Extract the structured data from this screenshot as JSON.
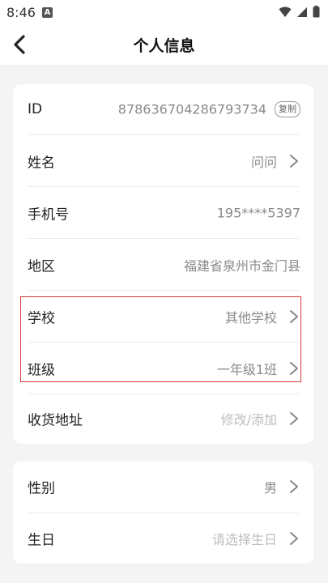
{
  "status_bar": {
    "time": "8:46",
    "notification_letter": "A"
  },
  "nav": {
    "title": "个人信息"
  },
  "profile": {
    "id": {
      "label": "ID",
      "value": "878636704286793734",
      "copy_label": "复制"
    },
    "name": {
      "label": "姓名",
      "value": "问问"
    },
    "phone": {
      "label": "手机号",
      "value": "195****5397"
    },
    "region": {
      "label": "地区",
      "value": "福建省泉州市金门县"
    },
    "school": {
      "label": "学校",
      "value": "其他学校"
    },
    "class": {
      "label": "班级",
      "value": "一年级1班"
    },
    "address": {
      "label": "收货地址",
      "value": "修改/添加"
    }
  },
  "personal": {
    "gender": {
      "label": "性别",
      "value": "男"
    },
    "birthday": {
      "label": "生日",
      "value": "请选择生日"
    }
  },
  "colors": {
    "highlight": "#d83a3a",
    "background": "#f4f4f4"
  }
}
